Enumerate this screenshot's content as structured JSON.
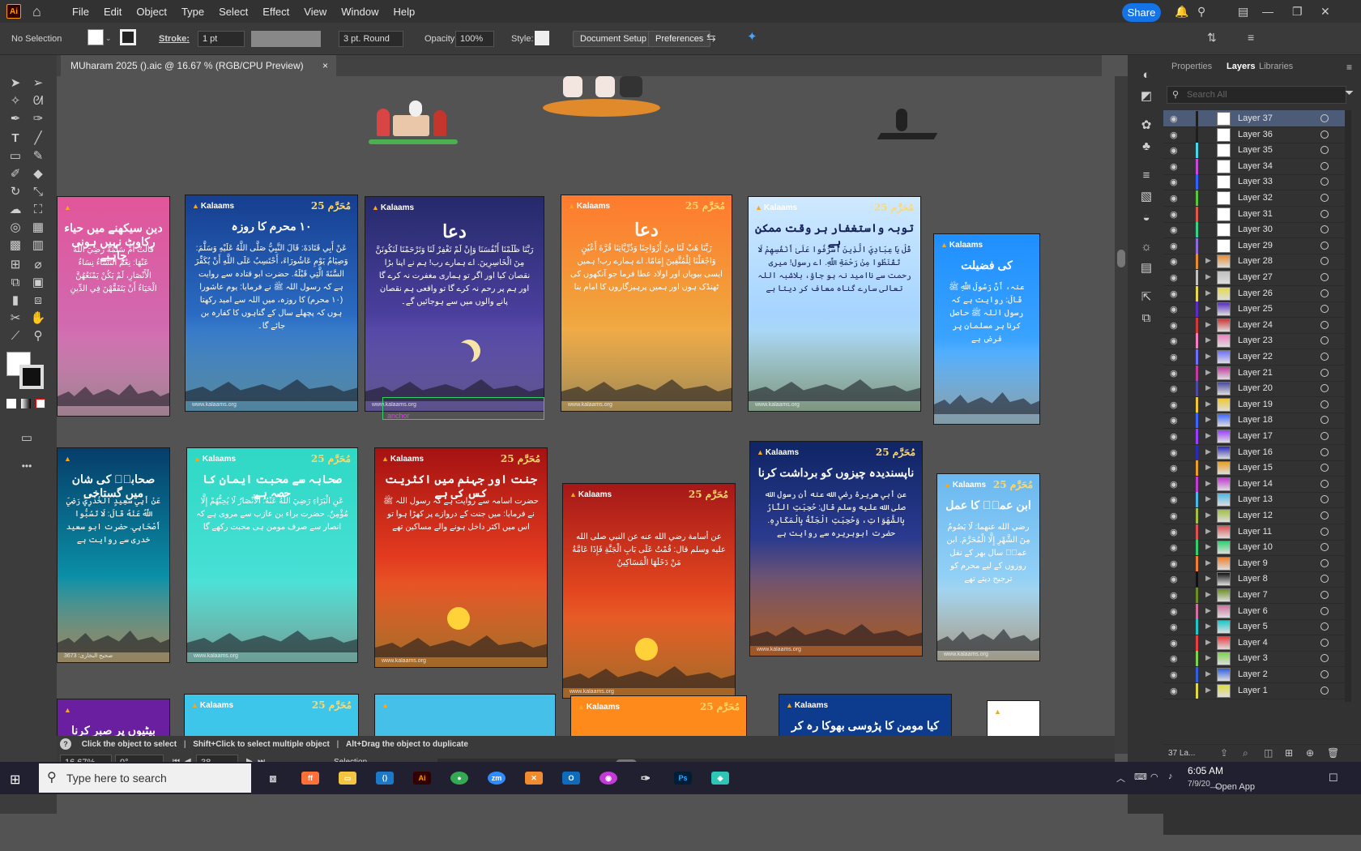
{
  "app": {
    "logo": "Ai",
    "home_icon": "home-icon",
    "accent": "#ff9a00"
  },
  "menu": [
    "File",
    "Edit",
    "Object",
    "Type",
    "Select",
    "Effect",
    "View",
    "Window",
    "Help"
  ],
  "share_label": "Share",
  "control": {
    "selection": "No Selection",
    "stroke_label": "Stroke:",
    "stroke_value": "1 pt",
    "brush_value": "3 pt. Round",
    "opacity_label": "Opacity:",
    "opacity_value": "100%",
    "style_label": "Style:",
    "doc_setup": "Document Setup",
    "preferences": "Preferences"
  },
  "tab": {
    "title": "MUharam 2025 ().aic @ 16.67 % (RGB/CPU Preview)",
    "close": "×"
  },
  "anchor_label": "anchor",
  "artboards": [
    {
      "brand": "",
      "muh": "",
      "title": "دین سیکھنے میں حیاء رکاوٹ نہیں ہونی چاہیے",
      "body": "قَالَتْ أُمُّ سَلَمَةَ رَضِيَ اللَّهُ عَنْهَا: نِعْمَ النِّسَاءُ نِسَاءُ الْأَنْصَارِ، لَمْ يَكُنْ يَمْنَعُهُنَّ الْحَيَاءُ أَنْ يَتَفَقَّهْنَ فِي الدِّينِ",
      "foot": ""
    },
    {
      "brand": "Kalaams",
      "muh": "مُحَرَّم 25",
      "title": "١٠ محرم کا روزہ",
      "body": "عَنْ أَبِي قَتَادَةَ: قَالَ النَّبِيُّ صَلَّى اللَّهُ عَلَيْهِ وَسَلَّمَ: وَصِيَامُ يَوْمِ عَاشُورَاءَ، أَحْتَسِبُ عَلَى اللَّهِ أَنْ يُكَفِّرَ السَّنَةَ الَّتِي قَبْلَهُ. حضرت ابو قتادہ سے روایت ہے کہ رسول اللہ ﷺ نے فرمایا: یوم عاشورا (١٠ محرم) کا روزہ، میں اللہ سے امید رکھتا ہوں کہ پچھلے سال کے گناہوں کا کفارہ بن جائے گا۔",
      "foot": "www.kalaams.org"
    },
    {
      "brand": "Kalaams",
      "muh": "",
      "title": "دعا",
      "body": "رَبَّنَا ظَلَمْنَا أَنْفُسَنَا وَإِنْ لَمْ تَغْفِرْ لَنَا وَتَرْحَمْنَا لَنَكُونَنَّ مِنَ الْخَاسِرِينَ. اے ہمارے رب! ہم نے اپنا بڑا نقصان کیا اور اگر تو ہماری مغفرت نہ کرے گا اور ہم پر رحم نہ کرے گا تو واقعی ہم نقصان پانے والوں میں سے ہوجائیں گے۔",
      "foot": "www.kalaams.org"
    },
    {
      "brand": "Kalaams",
      "muh": "مُحَرَّم 25",
      "title": "دعا",
      "body": "رَبَّنَا هَبْ لَنَا مِنْ أَزْوَاجِنَا وَذُرِّيَّاتِنَا قُرَّةَ أَعْيُنٍ وَاجْعَلْنَا لِلْمُتَّقِينَ إِمَامًا. اے ہمارے رب! ہمیں ایسی بیویاں اور اولاد عطا فرما جو آنکھوں کی ٹھنڈک ہوں اور ہمیں پرہیزگاروں کا امام بنا",
      "foot": "www.kalaams.org"
    },
    {
      "brand": "Kalaams",
      "muh": "مُحَرَّم 25",
      "title": "توبہ واستغفار ہر وقت ممکن ہے",
      "body": "قُلْ يَا عِبَادِيَ الَّذِينَ أَسْرَفُوا عَلَىٰ أَنْفُسِهِمْ لَا تَقْنَطُوا مِنْ رَحْمَةِ اللَّهِ. اے رسول! میری رحمت سے ناامید نہ ہو جاؤ، بلاشبہ اللہ تعالی سارے گناہ معاف کر دیتا ہے",
      "foot": "www.kalaams.org"
    },
    {
      "brand": "Kalaams",
      "muh": "",
      "title": "کی فضیلت",
      "body": "عنہ، أَنَّ رَسُولَ اللَّهِ ﷺ قَالَ: روایت ہے کہ رسول اللہ ﷺ حاصل کرنا ہر مسلمان پر فرض ہے",
      "foot": ""
    },
    {
      "brand": "",
      "muh": "",
      "title": "صحابہؓ کی شان میں گستاخی",
      "body": "عَنْ أَبِي سَعِيدٍ الْخُدْرِيِّ رَضِيَ اللَّهُ عَنْهُ قَالَ: لَا تَسُبُّوا أَصْحَابِي. حضرت ابو سعید خدری سے روایت ہے",
      "foot": "صحیح البخاری: 3673"
    },
    {
      "brand": "Kalaams",
      "muh": "مُحَرَّم 25",
      "title": "صحابہ سے محبت ایمان کا حصہ ہے",
      "body": "عَنِ الْبَرَاءِ رَضِيَ اللَّهُ عَنْهُ: الْأَنْصَارُ لَا يُحِبُّهُمْ إِلَّا مُؤْمِنٌ. حضرت براء بن عازب سے مروی ہے کہ انصار سے صرف مومن ہی محبت رکھے گا",
      "foot": "www.kalaams.org"
    },
    {
      "brand": "Kalaams",
      "muh": "مُحَرَّم 25",
      "title": "جنت اور جہنم میں اکثریت کس کی ہے",
      "body": "حضرت اسامہ سے روایت ہے کہ رسول اللہ ﷺ نے فرمایا: میں جنت کے دروازے پر کھڑا ہوا تو اس میں اکثر داخل ہونے والے مساکین تھے",
      "foot": "www.kalaams.org"
    },
    {
      "brand": "Kalaams",
      "muh": "مُحَرَّم 25",
      "title": "",
      "body": "عن أسامة رضي الله عنه عن النبي صلى الله عليه وسلم قال: قُمْتُ عَلَى بَابِ الْجَنَّةِ فَإِذَا عَامَّةُ مَنْ دَخَلَهَا الْمَسَاكِينُ",
      "foot": "www.kalaams.org"
    },
    {
      "brand": "Kalaams",
      "muh": "مُحَرَّم 25",
      "title": "ناپسندیدہ چیزوں کو برداشت کرنا",
      "body": "عن أبي هريرة رضي الله عنه أن رسول الله صلى الله عليه وسلم قال: حُجِبَتِ النَّارُ بِالشَّهَوَاتِ، وَحُجِبَتِ الْجَنَّةُ بِالْمَكَارِهِ. حضرت ابوہریرہ سے روایت ہے",
      "foot": "www.kalaams.org"
    },
    {
      "brand": "Kalaams",
      "muh": "مُحَرَّم 25",
      "title": "ابن عمرؓ کا عمل",
      "body": "رضي الله عنهما: لَا يَصُومُ مِنَ الشَّهْرِ إِلَّا الْمُحَرَّمَ. ابن عمرؓ سال بھر کے نفل روزوں کے لیے محرم کو ترجیح دیتے تھے",
      "foot": "www.kalaams.org"
    },
    {
      "brand": "",
      "muh": "",
      "title": "بیٹیوں پر صبر کرنا جنت",
      "body": "",
      "foot": ""
    },
    {
      "brand": "Kalaams",
      "muh": "مُحَرَّم 25",
      "title": "",
      "body": "",
      "foot": ""
    },
    {
      "brand": "",
      "muh": "",
      "title": "",
      "body": "",
      "foot": ""
    },
    {
      "brand": "Kalaams",
      "muh": "مُحَرَّم 25",
      "title": "",
      "body": "",
      "foot": ""
    },
    {
      "brand": "Kalaams",
      "muh": "",
      "title": "کیا مومن کا پڑوسی بھوکا رہ کر خود",
      "body": "",
      "foot": ""
    },
    {
      "brand": "",
      "muh": "",
      "title": "",
      "body": "",
      "foot": ""
    }
  ],
  "hint": {
    "q": "?",
    "a": "Click the object to select",
    "b": "Shift+Click to select multiple object",
    "c": "Alt+Drag the object to duplicate"
  },
  "status": {
    "zoom": "16.67%",
    "angle": "0°",
    "artboard": "38",
    "tool": "Selection"
  },
  "panel": {
    "tabs": [
      "Properties",
      "Layers",
      "Libraries"
    ],
    "search_placeholder": "Search All",
    "footer": "37 La...",
    "layers": [
      {
        "name": "Layer 37",
        "color": "#1e1e1e",
        "expand": false,
        "selected": true
      },
      {
        "name": "Layer 36",
        "color": "#1e1e1e",
        "expand": false
      },
      {
        "name": "Layer 35",
        "color": "#4ad6e8",
        "expand": false
      },
      {
        "name": "Layer 34",
        "color": "#c44bd6",
        "expand": false
      },
      {
        "name": "Layer 33",
        "color": "#2e63ff",
        "expand": false
      },
      {
        "name": "Layer 32",
        "color": "#57c83c",
        "expand": false
      },
      {
        "name": "Layer 31",
        "color": "#e2574c",
        "expand": false
      },
      {
        "name": "Layer 30",
        "color": "#37d28a",
        "expand": false
      },
      {
        "name": "Layer 29",
        "color": "#8e6bd8",
        "expand": false
      },
      {
        "name": "Layer 28",
        "color": "#e88c30",
        "expand": true
      },
      {
        "name": "Layer 27",
        "color": "#c0c0c0",
        "expand": true
      },
      {
        "name": "Layer 26",
        "color": "#e8d84a",
        "expand": true
      },
      {
        "name": "Layer 25",
        "color": "#5a2fc4",
        "expand": true
      },
      {
        "name": "Layer 24",
        "color": "#cc3a3a",
        "expand": true
      },
      {
        "name": "Layer 23",
        "color": "#f07ec0",
        "expand": true
      },
      {
        "name": "Layer 22",
        "color": "#6e6eff",
        "expand": true
      },
      {
        "name": "Layer 21",
        "color": "#c23ba0",
        "expand": true
      },
      {
        "name": "Layer 20",
        "color": "#4a4aa0",
        "expand": true
      },
      {
        "name": "Layer 19",
        "color": "#f0c830",
        "expand": true
      },
      {
        "name": "Layer 18",
        "color": "#3c66ff",
        "expand": true
      },
      {
        "name": "Layer 17",
        "color": "#9a3dff",
        "expand": true
      },
      {
        "name": "Layer 16",
        "color": "#2a2ab8",
        "expand": true
      },
      {
        "name": "Layer 15",
        "color": "#e8a020",
        "expand": true
      },
      {
        "name": "Layer 14",
        "color": "#c33cd0",
        "expand": true
      },
      {
        "name": "Layer 13",
        "color": "#4ab8e8",
        "expand": true
      },
      {
        "name": "Layer 12",
        "color": "#a0c040",
        "expand": true
      },
      {
        "name": "Layer 11",
        "color": "#e05050",
        "expand": true
      },
      {
        "name": "Layer 10",
        "color": "#30d070",
        "expand": true
      },
      {
        "name": "Layer 9",
        "color": "#f08030",
        "expand": true
      },
      {
        "name": "Layer 8",
        "color": "#111111",
        "expand": true
      },
      {
        "name": "Layer 7",
        "color": "#6b8e23",
        "expand": true
      },
      {
        "name": "Layer 6",
        "color": "#d070a0",
        "expand": true
      },
      {
        "name": "Layer 5",
        "color": "#1ec8c8",
        "expand": true
      },
      {
        "name": "Layer 4",
        "color": "#e84040",
        "expand": true
      },
      {
        "name": "Layer 3",
        "color": "#7cd24a",
        "expand": true
      },
      {
        "name": "Layer 2",
        "color": "#3060e0",
        "expand": true
      },
      {
        "name": "Layer 1",
        "color": "#dcdc40",
        "expand": true
      }
    ]
  },
  "taskbar": {
    "search_placeholder": "Type here to search",
    "time": "6:05 AM",
    "date": "7/9/20__",
    "open_app": "Open App"
  }
}
